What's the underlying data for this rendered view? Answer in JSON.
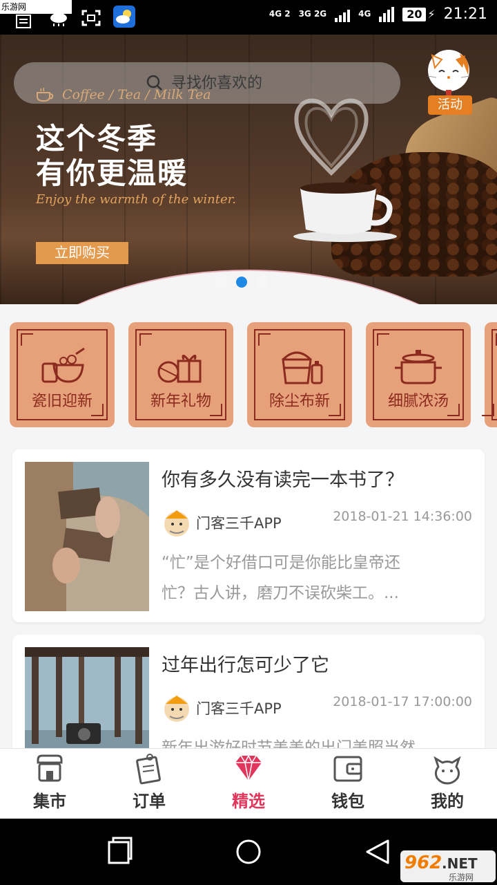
{
  "watermark": "乐游网 www.962.net",
  "status": {
    "net1": "4G 2",
    "net2": "3G 2G",
    "net3": "4G",
    "battery": "20",
    "time": "21:21"
  },
  "banner": {
    "search_placeholder": "寻找你喜欢的",
    "tagline": "Coffee / Tea / Milk Tea",
    "headline_line1": "这个冬季",
    "headline_line2": "有你更温暖",
    "subline": "Enjoy the warmth of the winter.",
    "buy_label": "立即购买",
    "activity_label": "活动",
    "slide_count": 3,
    "active_slide": 2
  },
  "categories": [
    {
      "label": "瓷旧迎新",
      "icon": "bowl-icon"
    },
    {
      "label": "新年礼物",
      "icon": "gift-icon"
    },
    {
      "label": "除尘布新",
      "icon": "bucket-icon"
    },
    {
      "label": "细腻浓汤",
      "icon": "pot-icon"
    }
  ],
  "articles": [
    {
      "title": "你有多久没有读完一本书了？",
      "author": "门客三千APP",
      "date": "2018-01-21 14:36:00",
      "summary_line1": "“忙”是个好借口可是你能比皇帝还",
      "summary_line2": "忙？古人讲，磨刀不误砍柴工。..."
    },
    {
      "title": "过年出行怎可少了它",
      "author": "门客三千APP",
      "date": "2018-01-17 17:00:00",
      "summary_line1": "新年出游好时节美美的出门美照当然",
      "summary_line2": ""
    }
  ],
  "tabs": [
    {
      "label": "集市",
      "icon": "market-icon"
    },
    {
      "label": "订单",
      "icon": "order-icon"
    },
    {
      "label": "精选",
      "icon": "diamond-icon",
      "active": true
    },
    {
      "label": "钱包",
      "icon": "wallet-icon"
    },
    {
      "label": "我的",
      "icon": "cat-icon"
    }
  ],
  "footer_logo": "962.NET 乐游网",
  "colors": {
    "accent": "#e0365c",
    "category_bg": "#e6a07a",
    "category_ink": "#8b2a1f",
    "buy": "#e49a4d",
    "activity": "#e67e22"
  }
}
